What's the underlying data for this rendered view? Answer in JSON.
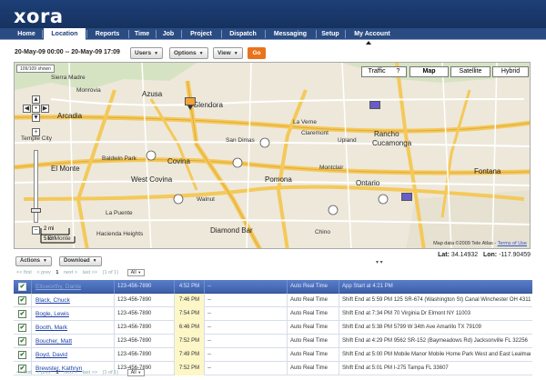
{
  "app": {
    "logo": "xora"
  },
  "nav": {
    "items": [
      {
        "label": "Home",
        "active": false
      },
      {
        "label": "Location",
        "active": true
      },
      {
        "label": "Reports",
        "active": false
      },
      {
        "label": "Time",
        "active": false
      },
      {
        "label": "Job",
        "active": false
      },
      {
        "label": "Project",
        "active": false
      },
      {
        "label": "Dispatch",
        "active": false
      },
      {
        "label": "Messaging",
        "active": false
      },
      {
        "label": "Setup",
        "active": false
      },
      {
        "label": "My Account",
        "active": false
      }
    ]
  },
  "toolbar": {
    "date_range": "20-May-09 00:00 -- 20-May-09 17:09",
    "users_label": "Users",
    "options_label": "Options",
    "view_label": "View",
    "go_label": "Go"
  },
  "map": {
    "shown_badge": "109/109 shown",
    "traffic_label": "Traffic",
    "traffic_help": "?",
    "map_label": "Map",
    "satellite_label": "Satellite",
    "hybrid_label": "Hybrid",
    "scale_mi": "2 mi",
    "scale_km": "5 km",
    "copyright_text": "Map data ©2009 Tele Atlas -",
    "terms_label": "Terms of Use",
    "places": {
      "sierra_madre": "Sierra Madre",
      "monrovia": "Monrovia",
      "arcadia": "Arcadia",
      "azusa": "Azusa",
      "glendora": "Glendora",
      "temple_city": "Temple City",
      "el_monte": "El Monte",
      "baldwin_park": "Baldwin Park",
      "covina": "Covina",
      "west_covina": "West Covina",
      "san_dimas": "San Dimas",
      "la_verne": "La Verne",
      "claremont": "Claremont",
      "upland": "Upland",
      "rancho": "Rancho",
      "cucamonga": "Cucamonga",
      "fontana": "Fontana",
      "pomona": "Pomona",
      "montclair": "Montclair",
      "ontario": "Ontario",
      "walnut": "Walnut",
      "la_puente": "La Puente",
      "hacienda_heights": "Hacienda Heights",
      "diamond_bar": "Diamond Bar",
      "chino": "Chino",
      "el_monte_small": "El Monte"
    }
  },
  "coords": {
    "lat_label": "Lat:",
    "lat": "34.14932",
    "lon_label": "Lon:",
    "lon": "-117.90459"
  },
  "actions": {
    "actions_label": "Actions",
    "download_label": "Download"
  },
  "pager": {
    "first": "<< first",
    "prev": "< prev",
    "page": "1",
    "next": "next >",
    "last": "last >>",
    "count": "(1 of 1)",
    "all": "All"
  },
  "table": {
    "header": {
      "check": "✔",
      "name": "Ellsworthy, Dante",
      "phone": "123-456-7890",
      "time": "4:52 PM",
      "dash": "--",
      "mode": "Auto Real Time",
      "status": "App Start at 4:21 PM"
    },
    "rows": [
      {
        "check": "✔",
        "name": "Black, Chuck",
        "phone": "123-456-7890",
        "time": "7:46 PM",
        "dash": "--",
        "mode": "Auto Real Time",
        "status": "Shift End at 5:59 PM 125 SR-674 (Washington St) Canal Winchester OH 43110"
      },
      {
        "check": "✔",
        "name": "Bogle, Lewis",
        "phone": "123-456-7890",
        "time": "7:54 PM",
        "dash": "--",
        "mode": "Auto Real Time",
        "status": "Shift End at 7:34 PM 70 Virginia Dr Elmont NY 11003"
      },
      {
        "check": "✔",
        "name": "Booth, Mark",
        "phone": "123-456-7890",
        "time": "6:46 PM",
        "dash": "--",
        "mode": "Auto Real Time",
        "status": "Shift End at 5:38 PM 5799 W 34th Ave Amarillo TX 79109"
      },
      {
        "check": "✔",
        "name": "Boucher, Matt",
        "phone": "123-456-7890",
        "time": "7:52 PM",
        "dash": "--",
        "mode": "Auto Real Time",
        "status": "Shift End at 4:29 PM 9562 SR-152 (Baymeadows Rd) Jacksonville FL 32256"
      },
      {
        "check": "✔",
        "name": "Boyd, David",
        "phone": "123-456-7890",
        "time": "7:49 PM",
        "dash": "--",
        "mode": "Auto Real Time",
        "status": "Shift End at 5:00 PM Mobile Manor Mobile Home Park West and East Lealman FL 33714"
      },
      {
        "check": "✔",
        "name": "Brewster, Kathryn",
        "phone": "123-456-7890",
        "time": "7:52 PM",
        "dash": "--",
        "mode": "Auto Real Time",
        "status": "Shift End at 5:01 PM I-275 Tampa FL 33607"
      }
    ]
  }
}
